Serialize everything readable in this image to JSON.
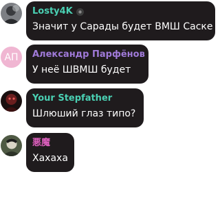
{
  "messages": [
    {
      "author": "Losty4K",
      "author_color": "#4ad0b3",
      "text": "Значит у Сарады будет ВМШ Саске",
      "avatar": "photo-avatar",
      "badge": "gear-emoji-icon"
    },
    {
      "author": "Александр Парфёнов",
      "author_color": "#a07ad9",
      "text": "У неё ШВМШ будет",
      "avatar_initials": "АП",
      "avatar_color": "#f0b6d2"
    },
    {
      "author": "Your Stepfather",
      "author_color": "#4ad0b3",
      "text": "Шлюший глаз типо?",
      "avatar": "photo-avatar"
    },
    {
      "author": "悪魔",
      "author_color": "#e060c0",
      "text": "Хахаха",
      "avatar": "photo-avatar"
    }
  ]
}
